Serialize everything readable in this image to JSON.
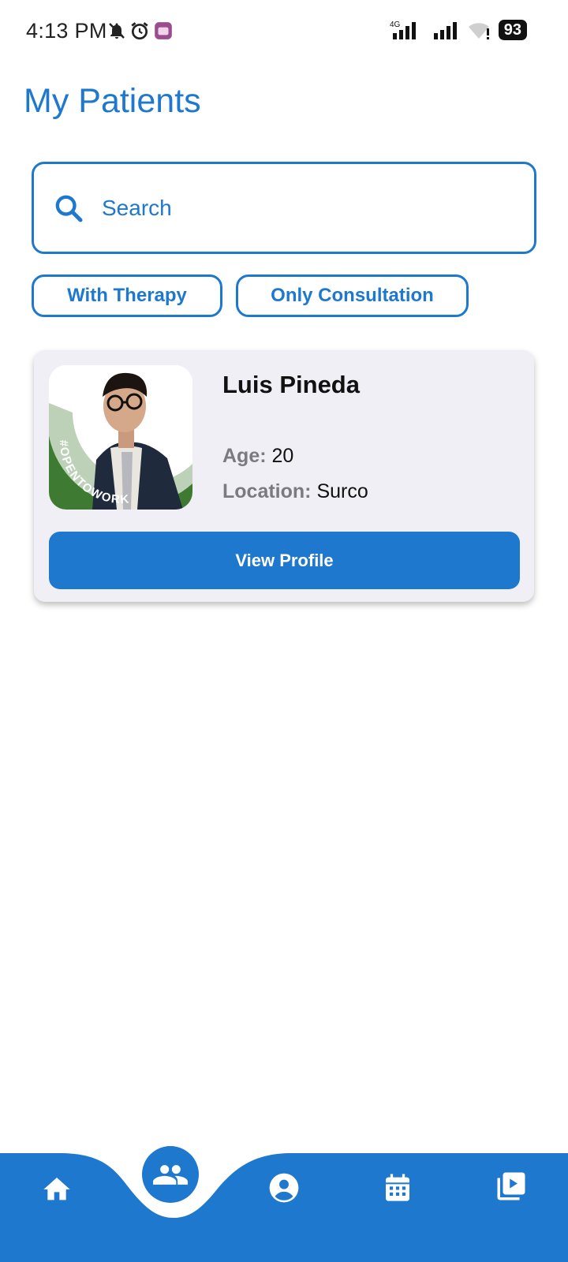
{
  "status_bar": {
    "time": "4:13 PM",
    "network": "4G",
    "battery": "93",
    "icons": [
      "mute-icon",
      "alarm-icon",
      "app-notification-icon",
      "signal-icon",
      "signal-icon",
      "wifi-icon",
      "battery-icon"
    ]
  },
  "page": {
    "title": "My Patients"
  },
  "search": {
    "placeholder": "Search",
    "value": ""
  },
  "filters": [
    {
      "label": "With Therapy"
    },
    {
      "label": "Only Consultation"
    }
  ],
  "patients": [
    {
      "name": "Luis Pineda",
      "age_label": "Age:",
      "age": "20",
      "location_label": "Location:",
      "location": "Surco",
      "avatar_badge_text": "#OPENTOWORK",
      "action_label": "View Profile"
    }
  ],
  "bottom_nav": {
    "items": [
      {
        "icon": "home-icon"
      },
      {
        "icon": "patients-icon",
        "active": true
      },
      {
        "icon": "profile-icon"
      },
      {
        "icon": "calendar-icon"
      },
      {
        "icon": "video-library-icon"
      }
    ]
  },
  "colors": {
    "primary": "#1e78cd",
    "card_bg": "#efeff5",
    "label_gray": "#7a7a80",
    "opentowork_green": "#3f7a32"
  }
}
